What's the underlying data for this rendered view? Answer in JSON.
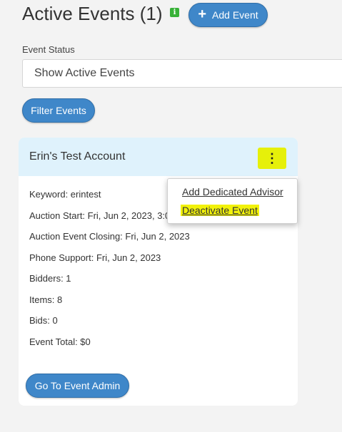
{
  "header": {
    "title": "Active Events (1)",
    "info_icon": "i",
    "add_event_label": "Add Event",
    "plus_icon": "+"
  },
  "filter": {
    "status_label": "Event Status",
    "status_value": "Show Active Events",
    "filter_button": "Filter Events"
  },
  "event": {
    "name": "Erin's Test Account",
    "menu_icon": "⋮",
    "details": [
      "Keyword: erintest",
      "Auction Start: Fri, Jun 2, 2023, 3:0",
      "Auction Event Closing: Fri, Jun 2, 2023",
      "Phone Support: Fri, Jun 2, 2023",
      "Bidders: 1",
      "Items: 8",
      "Bids: 0",
      "Event Total: $0"
    ],
    "admin_button": "Go To Event Admin"
  },
  "menu": {
    "items": [
      "Add Dedicated Advisor",
      "Deactivate Event"
    ]
  },
  "colors": {
    "accent": "#3f87c9",
    "highlight": "#e6f00a",
    "card_header": "#dff2fc",
    "info_icon": "#37b137"
  }
}
